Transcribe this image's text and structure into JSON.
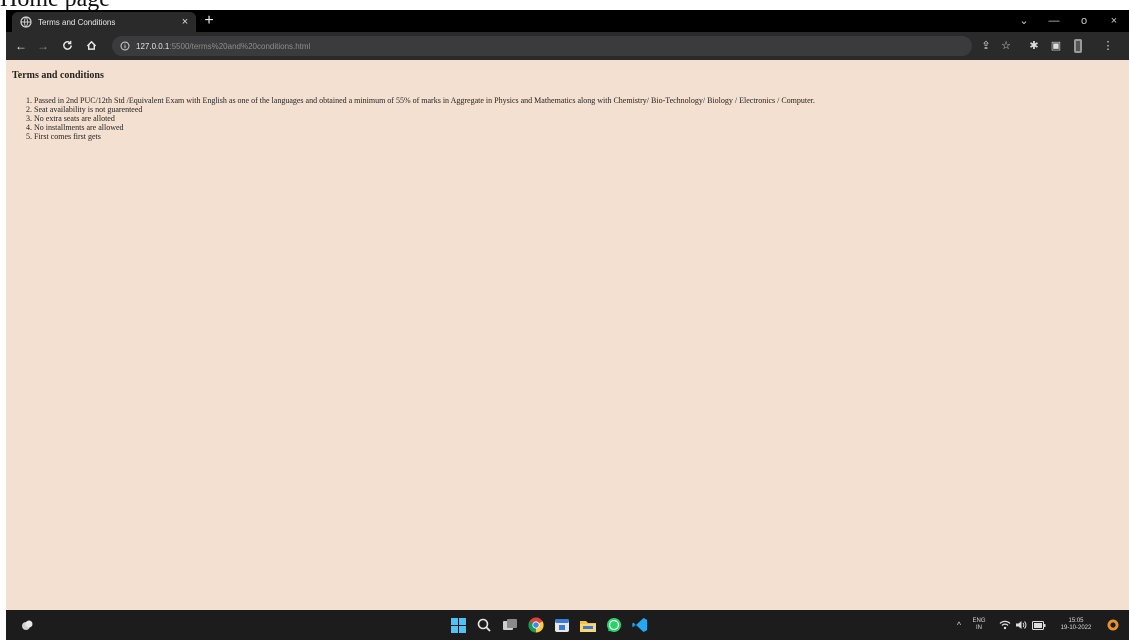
{
  "document": {
    "caption": "Home page"
  },
  "browser": {
    "tab": {
      "title": "Terms and Conditions",
      "close": "×"
    },
    "new_tab": "+",
    "window_controls": {
      "dropdown": "⌄",
      "minimize": "—",
      "restore": "o",
      "close": "×"
    },
    "address": {
      "host": "127.0.0.1",
      "path": ":5500/terms%20and%20conditions.html"
    }
  },
  "page": {
    "heading": "Terms and conditions",
    "terms": [
      "Passed in 2nd PUC/12th Std /Equivalent Exam with English as one of the languages and obtained a minimum of 55% of marks in Aggregate in Physics and Mathematics along with Chemistry/ Bio-Technology/ Biology / Electronics / Computer.",
      "Seat availability is not guarenteed",
      "No extra seats are alloted",
      "No installments are allowed",
      "First comes first gets"
    ]
  },
  "taskbar": {
    "language": "ENG",
    "region": "IN",
    "time": "15:05",
    "date": "19-10-2022",
    "icons": [
      "start-icon",
      "search-icon",
      "task-view-icon",
      "chrome-icon",
      "calendar-app-icon",
      "file-explorer-icon",
      "whatsapp-icon",
      "vscode-icon"
    ]
  },
  "colors": {
    "page_background": "#f4e0d0",
    "chrome_dark": "#2a2a2b",
    "taskbar": "#1c1c1c"
  }
}
